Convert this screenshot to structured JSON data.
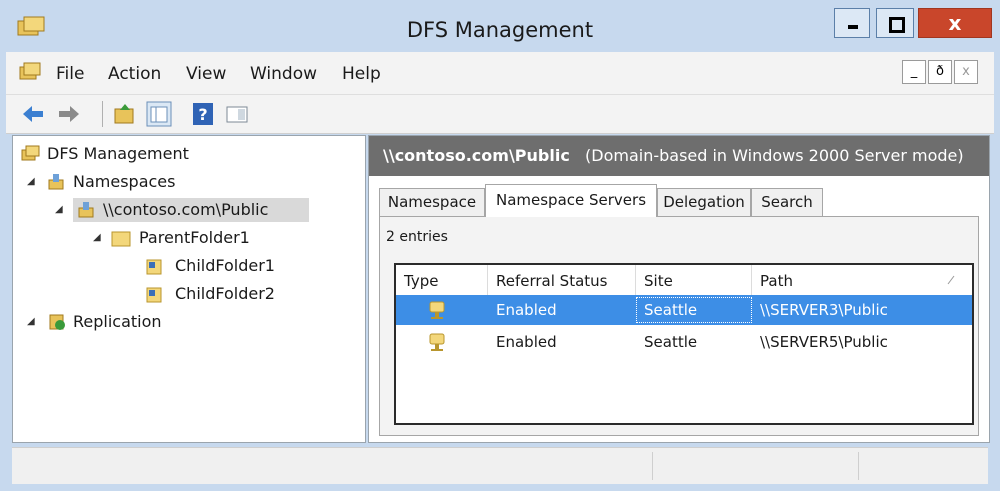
{
  "window": {
    "title": "DFS Management",
    "close_label": "x",
    "colors": {
      "frame": "#c7d9ee",
      "close": "#c9462b",
      "selection": "#3d8ee6",
      "header": "#6e6e6e"
    }
  },
  "menu": {
    "items": [
      "File",
      "Action",
      "View",
      "Window",
      "Help"
    ],
    "mdi": {
      "minimize": "_",
      "restore": "ð",
      "close": "x"
    }
  },
  "toolbar": {
    "buttons": [
      "back-arrow-icon",
      "forward-arrow-icon",
      "up-folder-icon",
      "show-hide-console-tree-icon",
      "help-icon",
      "action-pane-icon"
    ]
  },
  "tree": {
    "root": "DFS Management",
    "namespaces": "Namespaces",
    "namespace": "\\\\contoso.com\\Public",
    "parent_folder": "ParentFolder1",
    "child1": "ChildFolder1",
    "child2": "ChildFolder2",
    "replication": "Replication"
  },
  "details": {
    "path": "\\\\contoso.com\\Public",
    "mode": "(Domain-based in Windows 2000 Server mode)",
    "tabs": [
      "Namespace",
      "Namespace Servers",
      "Delegation",
      "Search"
    ],
    "active_tab": "Namespace Servers",
    "entries": "2 entries",
    "columns": [
      "Type",
      "Referral Status",
      "Site",
      "Path"
    ],
    "rows": [
      {
        "status": "Enabled",
        "site": "Seattle",
        "path": "\\\\SERVER3\\Public"
      },
      {
        "status": "Enabled",
        "site": "Seattle",
        "path": "\\\\SERVER5\\Public"
      }
    ]
  }
}
